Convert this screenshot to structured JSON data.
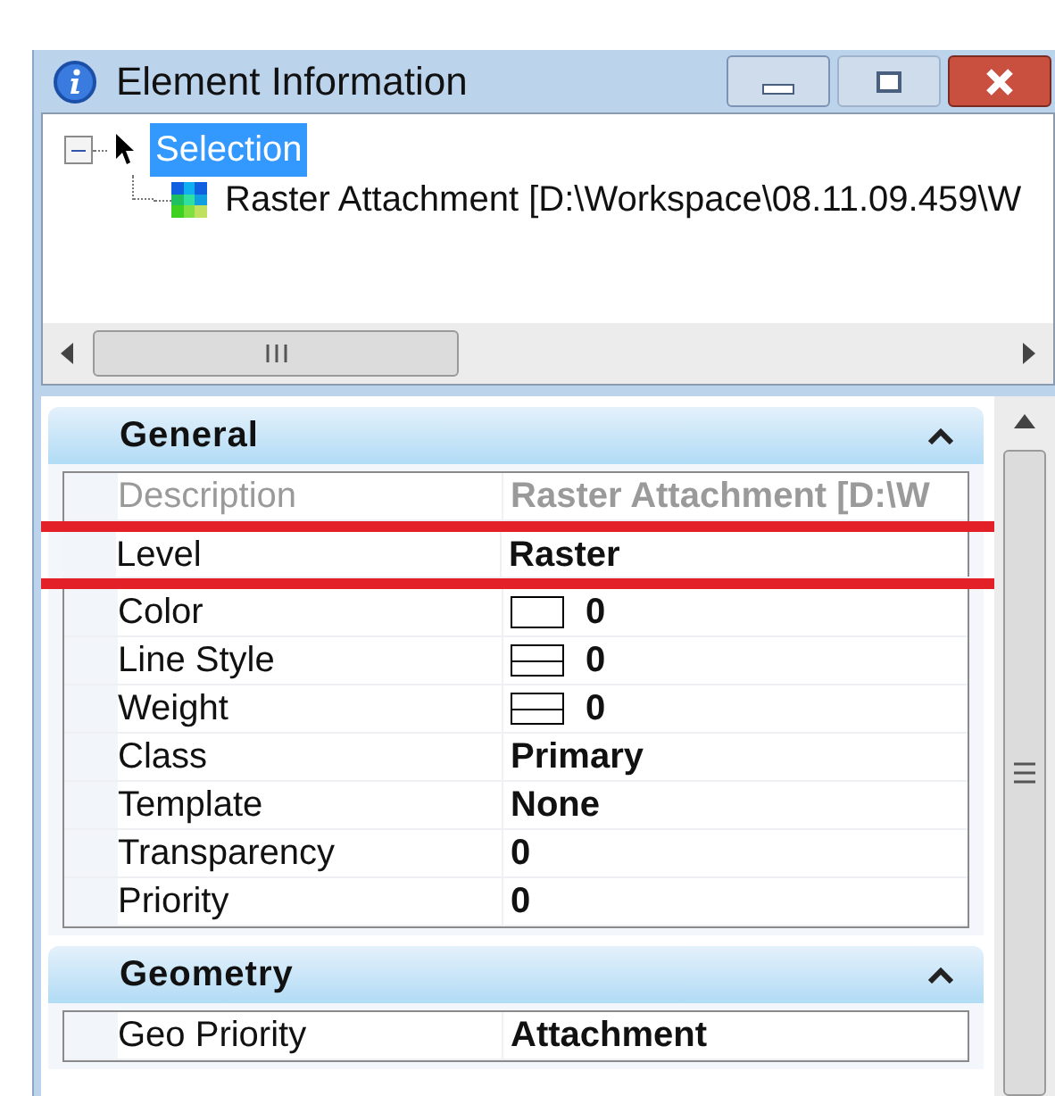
{
  "window": {
    "title": "Element Information"
  },
  "tree": [
    {
      "label": "Selection",
      "selected": true,
      "expanded": true,
      "children": [
        {
          "label": "Raster Attachment [D:\\Workspace\\08.11.09.459\\W",
          "selected": false
        }
      ]
    }
  ],
  "sections": [
    {
      "title": "General",
      "expanded": true,
      "rows": [
        {
          "label": "Description",
          "value": "Raster Attachment [D:\\W",
          "kind": "text",
          "disabled": true,
          "highlighted": false
        },
        {
          "label": "Level",
          "value": "Raster",
          "kind": "text",
          "disabled": false,
          "highlighted": true
        },
        {
          "label": "Color",
          "value": "0",
          "kind": "swatch",
          "disabled": false,
          "highlighted": false
        },
        {
          "label": "Line Style",
          "value": "0",
          "kind": "line",
          "disabled": false,
          "highlighted": false
        },
        {
          "label": "Weight",
          "value": "0",
          "kind": "line",
          "disabled": false,
          "highlighted": false
        },
        {
          "label": "Class",
          "value": "Primary",
          "kind": "text",
          "disabled": false,
          "highlighted": false
        },
        {
          "label": "Template",
          "value": "None",
          "kind": "text",
          "disabled": false,
          "highlighted": false
        },
        {
          "label": "Transparency",
          "value": "0",
          "kind": "text",
          "disabled": false,
          "highlighted": false
        },
        {
          "label": "Priority",
          "value": "0",
          "kind": "text",
          "disabled": false,
          "highlighted": false
        }
      ]
    },
    {
      "title": "Geometry",
      "expanded": true,
      "rows": [
        {
          "label": "Geo Priority",
          "value": "Attachment",
          "kind": "text",
          "disabled": false,
          "highlighted": false
        }
      ]
    }
  ]
}
